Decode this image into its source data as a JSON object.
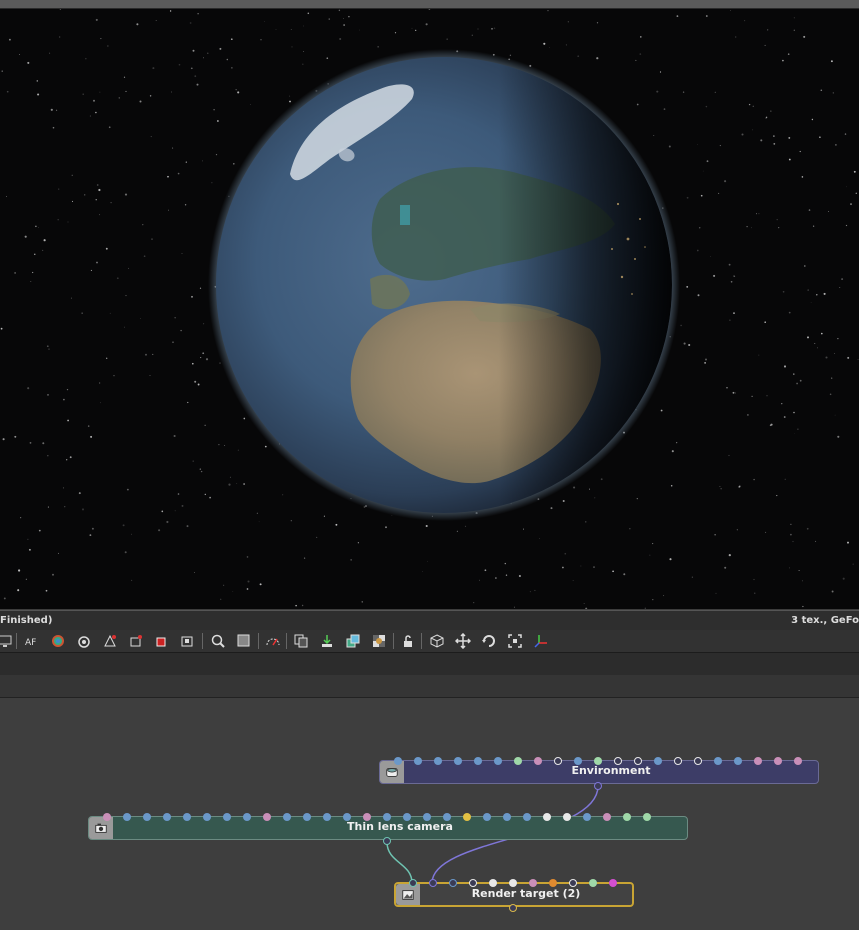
{
  "status": {
    "left_text": "Finished)",
    "right_text": "3 tex., GeFo"
  },
  "toolbar": {
    "buttons": [
      {
        "name": "display-icon"
      },
      {
        "name": "aperture-icon"
      },
      {
        "name": "color-icon"
      },
      {
        "name": "camera-icon"
      },
      {
        "name": "light-icon"
      },
      {
        "name": "render-settings-icon"
      },
      {
        "name": "red-square-icon"
      },
      {
        "name": "viewport-icon"
      },
      {
        "name": "zoom-icon"
      },
      {
        "name": "region-icon"
      },
      {
        "name": "speed-icon"
      },
      {
        "name": "copy-icon"
      },
      {
        "name": "import-icon"
      },
      {
        "name": "layers-icon"
      },
      {
        "name": "checker-icon"
      },
      {
        "name": "lock-icon"
      },
      {
        "name": "cube-icon"
      },
      {
        "name": "move-icon"
      },
      {
        "name": "rotate-icon"
      },
      {
        "name": "fit-icon"
      },
      {
        "name": "axis-icon"
      }
    ]
  },
  "nodes": {
    "environment": {
      "label": "Environment",
      "color": "#3d3d67",
      "border": "#6a6a95"
    },
    "camera": {
      "label": "Thin lens camera",
      "color": "#36584f",
      "border": "#6b8b82"
    },
    "render_target": {
      "label": "Render target (2)",
      "color": "#424242",
      "border": "#c8a434"
    }
  },
  "colors": {
    "wire_camera": "#6fc4b2",
    "wire_environment": "#7f76d8",
    "pin_blue": "#6b98c9",
    "pin_pink": "#c98fb8",
    "pin_green": "#9fd8a8",
    "pin_yellow": "#e2c043",
    "pin_orange": "#e08b30",
    "pin_magenta": "#d34fd1"
  }
}
